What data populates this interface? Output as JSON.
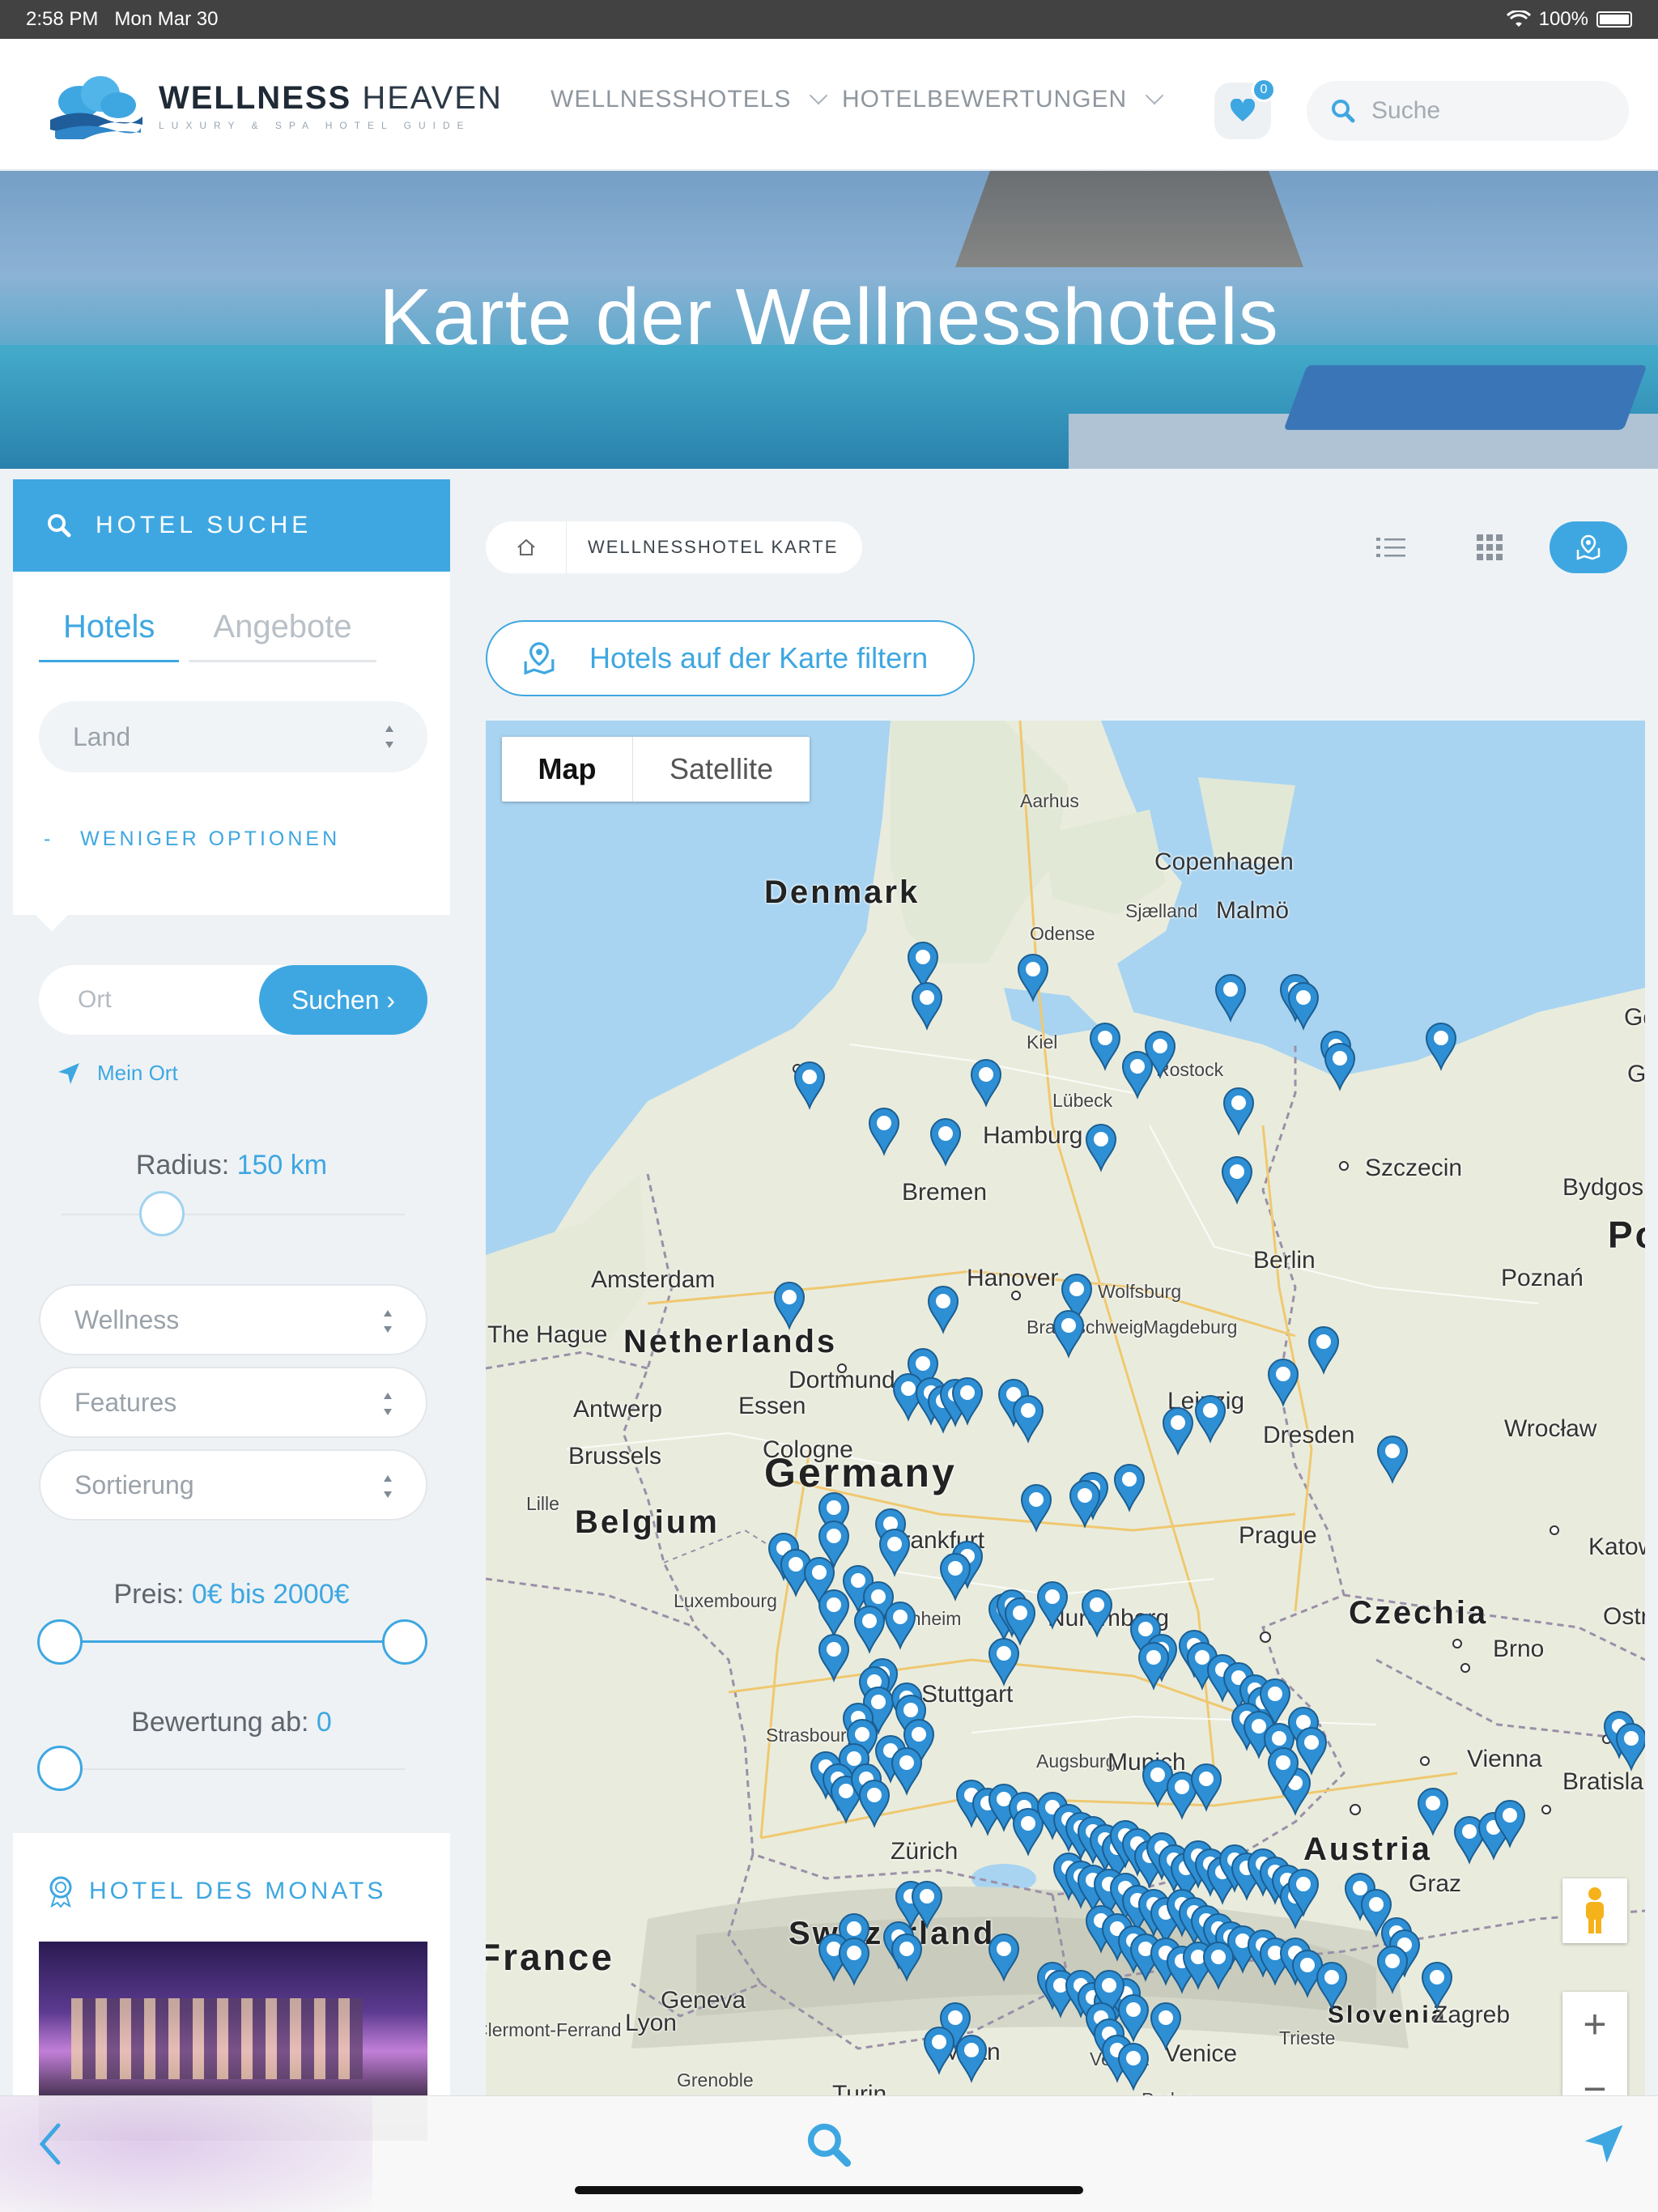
{
  "status_bar": {
    "time": "2:58 PM",
    "date": "Mon Mar 30",
    "battery": "100%"
  },
  "header": {
    "logo": {
      "word_bold": "WELLNESS",
      "word_light": " HEAVEN",
      "tagline": "LUXURY & SPA HOTEL GUIDE"
    },
    "nav": [
      "WELLNESSHOTELS",
      "HOTELBEWERTUNGEN"
    ],
    "favorites_count": "0",
    "search_placeholder": "Suche"
  },
  "hero": {
    "title": "Karte der Wellnesshotels"
  },
  "sidebar": {
    "header": "HOTEL SUCHE",
    "tabs": [
      "Hotels",
      "Angebote"
    ],
    "land": "Land",
    "less_options": "WENIGER OPTIONEN",
    "ort_placeholder": "Ort",
    "search_button": "Suchen",
    "my_location": "Mein Ort",
    "radius_label": "Radius:",
    "radius_value": "150 km",
    "selects": [
      "Wellness",
      "Features",
      "Sortierung"
    ],
    "price_label": "Preis:",
    "price_value": "0€ bis 2000€",
    "rating_label": "Bewertung ab:",
    "rating_value": "0",
    "hotel_of_month": "HOTEL DES MONATS"
  },
  "main": {
    "breadcrumb": "WELLNESSHOTEL KARTE",
    "filter_button": "Hotels auf der Karte filtern"
  },
  "map": {
    "types": [
      "Map",
      "Satellite"
    ],
    "labels": {
      "countries": [
        "Denmark",
        "Netherlands",
        "Belgium",
        "Germany",
        "Czechia",
        "Switzerland",
        "Austria",
        "Slovenia",
        "France",
        "Po"
      ],
      "cities": [
        "Aarhus",
        "Copenhagen",
        "Malmö",
        "Odense",
        "Sjælland",
        "Kiel",
        "Rostock",
        "Lübeck",
        "Hamburg",
        "Szczecin",
        "Bremen",
        "Bydgos",
        "Berlin",
        "Poznań",
        "Hanover",
        "Wolfsburg",
        "Amsterdam",
        "The Hague",
        "Braunschweig",
        "Magdeburg",
        "Dortmund",
        "Essen",
        "Antwerp",
        "Leipzig",
        "Brussels",
        "Cologne",
        "Dresden",
        "Wrocław",
        "Lille",
        "Prague",
        "Frankfurt",
        "Luxembourg",
        "Mannheim",
        "Nuremberg",
        "Ostr",
        "Brno",
        "Stuttgart",
        "Strasbourg",
        "Augsburg",
        "Munich",
        "Vienna",
        "Bratisla",
        "Zürich",
        "Graz",
        "Geneva",
        "Lyon",
        "Milan",
        "Venice",
        "Verona",
        "Trieste",
        "Zagreb",
        "Grenoble",
        "Clermont-Ferrand",
        "Turin",
        "Padua",
        "Gd",
        "G",
        "Katow"
      ]
    },
    "marker_color": "#2e8fd4"
  },
  "colors": {
    "accent": "#3ea7e1",
    "water": "#a6d4f2",
    "land": "#e8ecdf"
  }
}
